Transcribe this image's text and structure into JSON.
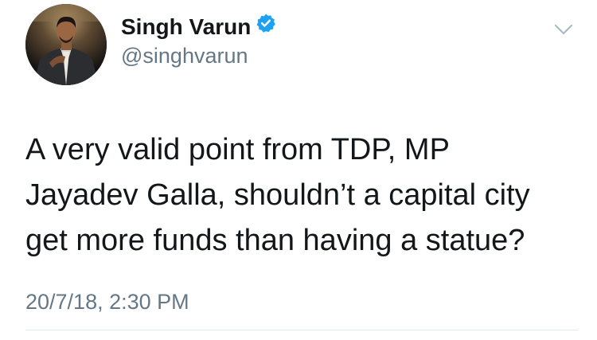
{
  "author": {
    "display_name": "Singh Varun",
    "handle": "@singhvarun",
    "verified": true,
    "avatar_icon": "profile-photo"
  },
  "tweet": {
    "text_lines": [
      "A very valid point from TDP, MP",
      "Jayadev Galla, shouldn’t a capital city",
      "get more funds than having a statue?"
    ],
    "timestamp": "20/7/18, 2:30 PM"
  },
  "icons": {
    "verified": "verified-badge-icon",
    "menu": "chevron-down-icon"
  },
  "colors": {
    "verified_blue": "#1da1f2",
    "secondary_text": "#657786",
    "primary_text": "#14171a",
    "divider": "#e1e8ed"
  }
}
